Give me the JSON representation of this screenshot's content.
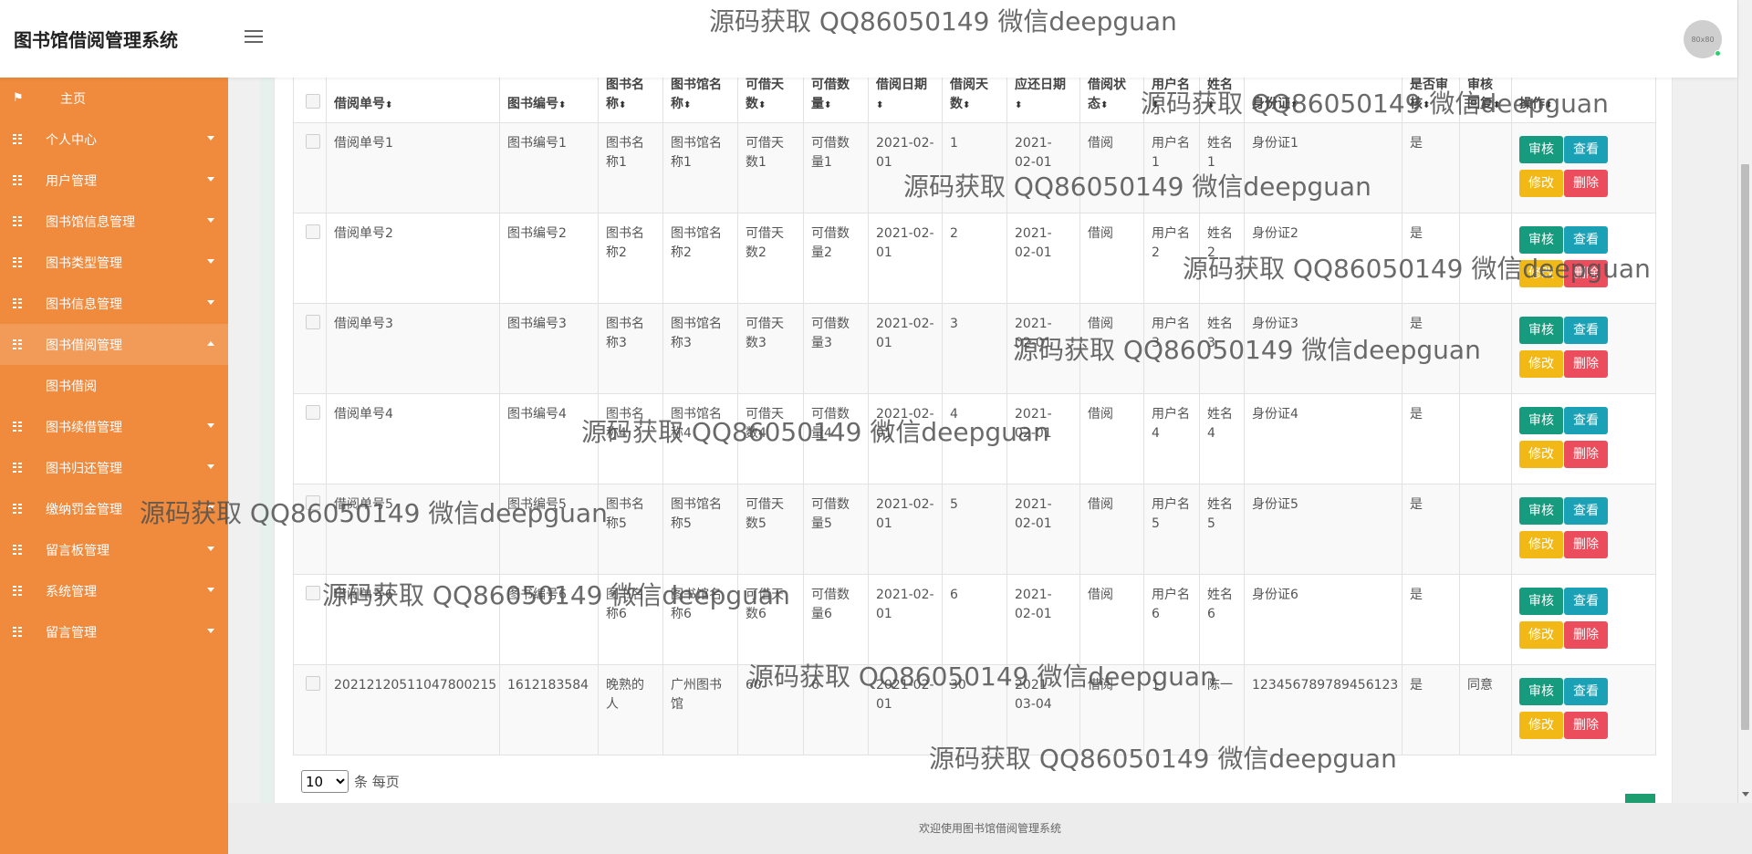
{
  "header": {
    "app_title": "图书馆借阅管理系统",
    "avatar_text": "80x80"
  },
  "sidebar": {
    "items": [
      {
        "label": "主页",
        "icon": "flag-icon"
      },
      {
        "label": "个人中心",
        "icon": "grid-icon"
      },
      {
        "label": "用户管理",
        "icon": "grid-icon"
      },
      {
        "label": "图书馆信息管理",
        "icon": "grid-icon"
      },
      {
        "label": "图书类型管理",
        "icon": "grid-icon"
      },
      {
        "label": "图书信息管理",
        "icon": "grid-icon"
      },
      {
        "label": "图书借阅管理",
        "icon": "grid-icon",
        "expanded": true,
        "sub": [
          "图书借阅"
        ]
      },
      {
        "label": "图书续借管理",
        "icon": "grid-icon"
      },
      {
        "label": "图书归还管理",
        "icon": "grid-icon"
      },
      {
        "label": "缴纳罚金管理",
        "icon": "grid-icon"
      },
      {
        "label": "留言板管理",
        "icon": "grid-icon"
      },
      {
        "label": "系统管理",
        "icon": "grid-icon"
      },
      {
        "label": "留言管理",
        "icon": "grid-icon"
      }
    ]
  },
  "table": {
    "columns": [
      "借阅单号",
      "图书编号",
      "图书名称",
      "图书馆名称",
      "可借天数",
      "可借数量",
      "借阅日期",
      "借阅天数",
      "应还日期",
      "借阅状态",
      "用户名",
      "姓名",
      "身份证",
      "是否审核",
      "审核回复",
      "操作"
    ],
    "sort_icon": "⬍",
    "rows": [
      [
        "借阅单号1",
        "图书编号1",
        "图书名称1",
        "图书馆名称1",
        "可借天数1",
        "可借数量1",
        "2021-02-01",
        "1",
        "2021-02-01",
        "借阅",
        "用户名1",
        "姓名1",
        "身份证1",
        "是",
        ""
      ],
      [
        "借阅单号2",
        "图书编号2",
        "图书名称2",
        "图书馆名称2",
        "可借天数2",
        "可借数量2",
        "2021-02-01",
        "2",
        "2021-02-01",
        "借阅",
        "用户名2",
        "姓名2",
        "身份证2",
        "是",
        ""
      ],
      [
        "借阅单号3",
        "图书编号3",
        "图书名称3",
        "图书馆名称3",
        "可借天数3",
        "可借数量3",
        "2021-02-01",
        "3",
        "2021-02-01",
        "借阅",
        "用户名3",
        "姓名3",
        "身份证3",
        "是",
        ""
      ],
      [
        "借阅单号4",
        "图书编号4",
        "图书名称4",
        "图书馆名称4",
        "可借天数4",
        "可借数量4",
        "2021-02-01",
        "4",
        "2021-02-01",
        "借阅",
        "用户名4",
        "姓名4",
        "身份证4",
        "是",
        ""
      ],
      [
        "借阅单号5",
        "图书编号5",
        "图书名称5",
        "图书馆名称5",
        "可借天数5",
        "可借数量5",
        "2021-02-01",
        "5",
        "2021-02-01",
        "借阅",
        "用户名5",
        "姓名5",
        "身份证5",
        "是",
        ""
      ],
      [
        "借阅单号6",
        "图书编号6",
        "图书名称6",
        "图书馆名称6",
        "可借天数6",
        "可借数量6",
        "2021-02-01",
        "6",
        "2021-02-01",
        "借阅",
        "用户名6",
        "姓名6",
        "身份证6",
        "是",
        ""
      ],
      [
        "20212120511047800215",
        "1612183584",
        "晚熟的人",
        "广州图书馆",
        "60",
        "6",
        "2021-02-01",
        "30",
        "2021-03-04",
        "借阅",
        "1",
        "陈一",
        "123456789789456123",
        "是",
        "同意"
      ]
    ],
    "actions": {
      "review": "审核",
      "view": "查看",
      "edit": "修改",
      "delete": "删除"
    }
  },
  "pager": {
    "page_size": "10",
    "page_size_options": [
      "10"
    ],
    "suffix": "条 每页"
  },
  "footer": {
    "text": "欢迎使用图书馆借阅管理系统"
  },
  "watermark": {
    "text": "源码获取 QQ86050149 微信deepguan"
  },
  "colors": {
    "sidebar": "#f08a3c",
    "review": "#179b7e",
    "view": "#1aa1b6",
    "edit": "#f2b916",
    "delete": "#eb4d5c"
  }
}
